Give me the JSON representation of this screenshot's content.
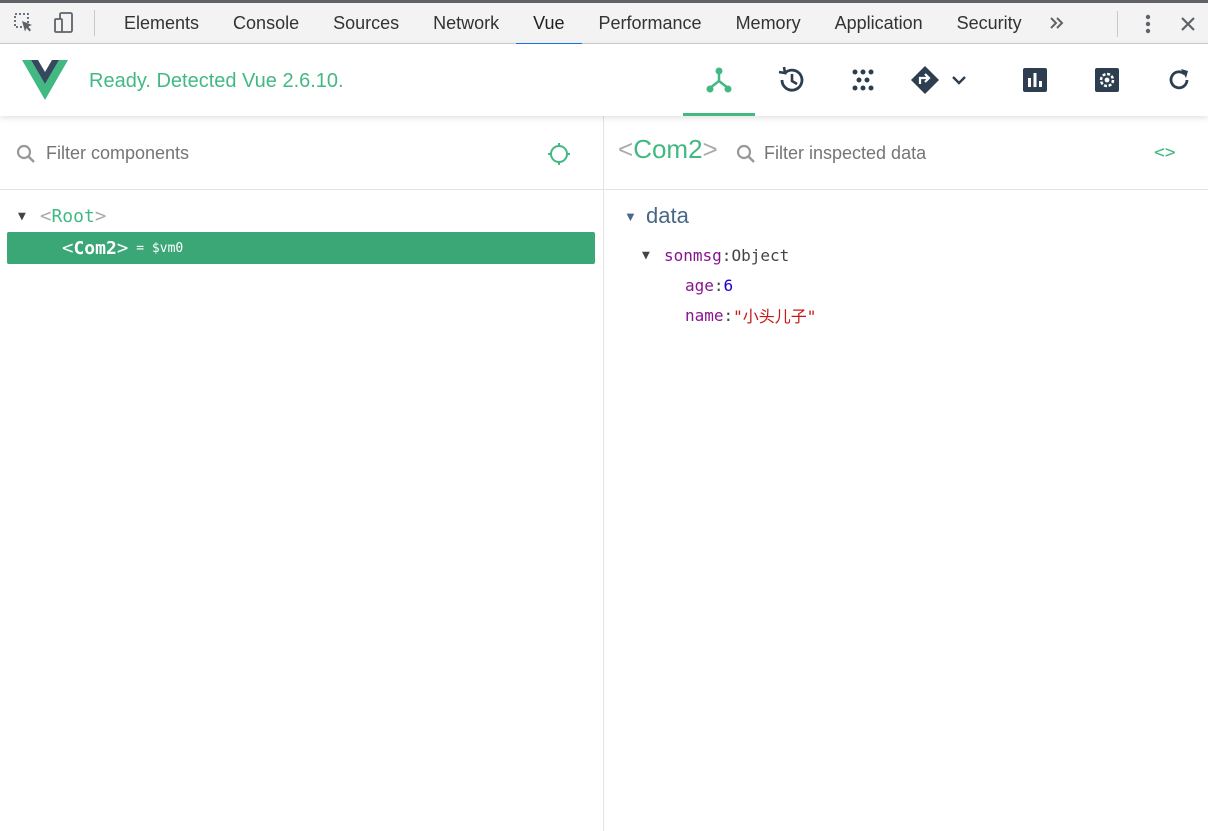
{
  "devtools": {
    "tabs": [
      "Elements",
      "Console",
      "Sources",
      "Network",
      "Vue",
      "Performance",
      "Memory",
      "Application",
      "Security"
    ],
    "active_tab": "Vue",
    "more_symbol": "»"
  },
  "vue_header": {
    "status": "Ready. Detected Vue 2.6.10.",
    "brand_color": "#42b983",
    "tools": [
      "components-icon",
      "vuex-history-icon",
      "events-icon",
      "routing-icon",
      "performance-icon",
      "settings-icon",
      "refresh-icon"
    ]
  },
  "left_pane": {
    "filter_placeholder": "Filter components",
    "tree": {
      "root": {
        "open_bracket": "<",
        "name": "Root",
        "close_bracket": ">"
      },
      "child": {
        "open_bracket": "<",
        "name": "Com2",
        "close_bracket": ">",
        "ref": "= $vm0"
      }
    }
  },
  "right_pane": {
    "title_open": "<",
    "title_name": "Com2",
    "title_close": ">",
    "filter_placeholder": "Filter inspected data",
    "code_toggle": "<>",
    "section": "data",
    "object": {
      "key": "sonmsg",
      "type": "Object"
    },
    "fields": [
      {
        "key": "age",
        "value": "6"
      },
      {
        "key": "name",
        "value": "\"小头儿子\""
      }
    ]
  }
}
